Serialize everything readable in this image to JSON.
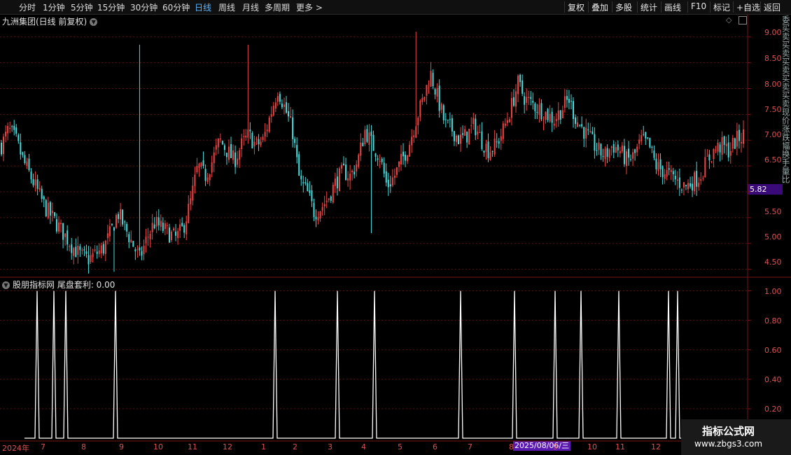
{
  "toolbar": {
    "periods": [
      "分时",
      "1分钟",
      "5分钟",
      "15分钟",
      "30分钟",
      "60分钟",
      "日线",
      "周线",
      "月线",
      "多周期",
      "更多 >"
    ],
    "active_period": "日线",
    "actions": [
      "复权",
      "叠加",
      "多股",
      "统计",
      "画线",
      "F10",
      "标记",
      "+自选",
      "返回"
    ]
  },
  "main": {
    "title": "九洲集团(日线 前复权)",
    "y_labels": [
      "9.00",
      "8.50",
      "8.00",
      "7.50",
      "7.00",
      "6.50",
      "5.82",
      "5.50",
      "5.00",
      "4.50"
    ],
    "current_price": "5.82"
  },
  "indicator": {
    "title": "股朋指标网  尾盘套利: 0.00",
    "y_labels": [
      "1.00",
      "0.80",
      "0.60",
      "0.40",
      "0.20"
    ]
  },
  "x_axis": {
    "labels": [
      "2024年",
      "7",
      "8",
      "9",
      "10",
      "11",
      "12",
      "1",
      "2",
      "3",
      "4",
      "5",
      "6",
      "7",
      "8",
      "9",
      "10",
      "11",
      "12"
    ],
    "cursor_date": "2025/08/06/三"
  },
  "right_strip_text": "委买卖买卖买卖买卖买卖现价涨跌幅换手量比",
  "watermark": {
    "line1": "指标公式网",
    "line2": "www.zbgs3.com"
  },
  "colors": {
    "up": "#ee4444",
    "down": "#44dddd",
    "grid": "#5a1010",
    "signal": "#ffffff",
    "accent": "#5ab4ff"
  },
  "chart_data": [
    {
      "type": "candlestick",
      "title": "九洲集团(日线 前复权)",
      "ylim": [
        4.4,
        9.2
      ],
      "close_series_approx": [
        6.9,
        7.2,
        7.0,
        6.6,
        6.3,
        6.0,
        5.7,
        5.5,
        5.3,
        5.1,
        4.9,
        4.75,
        4.7,
        4.8,
        4.9,
        5.2,
        5.6,
        5.3,
        5.0,
        4.7,
        5.1,
        5.4,
        5.3,
        5.2,
        5.1,
        5.3,
        5.8,
        6.5,
        6.3,
        6.6,
        7.0,
        6.8,
        6.6,
        6.9,
        7.1,
        6.9,
        7.0,
        7.5,
        8.0,
        7.6,
        7.2,
        6.2,
        6.0,
        5.6,
        5.7,
        5.9,
        6.2,
        6.4,
        6.3,
        6.6,
        7.2,
        6.9,
        6.7,
        6.1,
        6.3,
        6.6,
        6.9,
        7.4,
        7.8,
        8.3,
        7.8,
        7.3,
        7.2,
        7.0,
        7.1,
        7.3,
        7.0,
        6.8,
        6.9,
        7.2,
        7.6,
        8.1,
        7.8,
        7.7,
        7.6,
        7.5,
        7.4,
        7.6,
        7.8,
        7.4,
        7.2,
        7.0,
        6.8,
        6.7,
        6.9,
        6.8,
        6.6,
        6.7,
        7.0,
        6.9,
        6.5,
        6.4,
        6.3,
        6.2,
        6.1,
        6.2,
        6.3,
        6.6,
        6.8,
        6.9,
        6.8,
        7.0,
        7.1
      ],
      "series": [
        {
          "name": "尾盘套利",
          "signal_bars": [
            53,
            77,
            94,
            165,
            393,
            482,
            535,
            658,
            735,
            793,
            830,
            884,
            955,
            968
          ]
        }
      ]
    },
    {
      "type": "line",
      "title": "尾盘套利",
      "ylim": [
        0,
        1.05
      ],
      "current_value": 0.0
    }
  ]
}
